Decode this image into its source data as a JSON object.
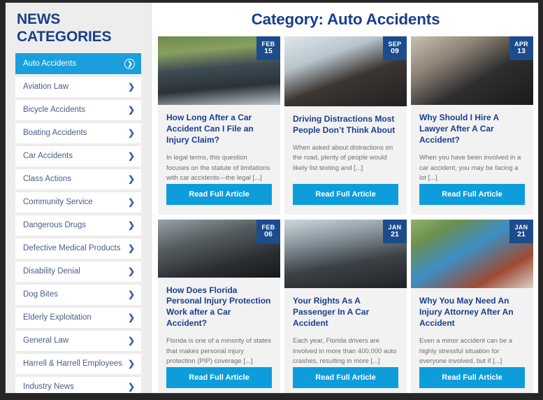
{
  "sidebar": {
    "heading": "NEWS\nCATEGORIES",
    "chevron_icon": "chevron-right-icon",
    "items": [
      {
        "label": "Auto Accidents",
        "active": true
      },
      {
        "label": "Aviation Law",
        "active": false
      },
      {
        "label": "Bicycle Accidents",
        "active": false
      },
      {
        "label": "Boating Accidents",
        "active": false
      },
      {
        "label": "Car Accidents",
        "active": false
      },
      {
        "label": "Class Actions",
        "active": false
      },
      {
        "label": "Community Service",
        "active": false
      },
      {
        "label": "Dangerous Drugs",
        "active": false
      },
      {
        "label": "Defective Medical Products",
        "active": false
      },
      {
        "label": "Disability Denial",
        "active": false
      },
      {
        "label": "Dog Bites",
        "active": false
      },
      {
        "label": "Elderly Exploitation",
        "active": false
      },
      {
        "label": "General Law",
        "active": false
      },
      {
        "label": "Harrell & Harrell Employees",
        "active": false
      },
      {
        "label": "Industry News",
        "active": false
      }
    ]
  },
  "main": {
    "page_title": "Category: Auto Accidents",
    "cta_label": "Read Full Article",
    "articles": [
      {
        "date_month": "FEB",
        "date_day": "15",
        "title": "How Long After a Car Accident Can I File an Injury Claim?",
        "excerpt": "In legal terms, this question focuses on the statute of limitations with car accidents—the legal [...]",
        "cta": "Read Full Article",
        "image_alt": "car-accident-driver-photo"
      },
      {
        "date_month": "SEP",
        "date_day": "09",
        "title": "Driving Distractions Most People Don’t Think About",
        "excerpt": "When asked about distractions on the road, plenty of people would likely list texting and [...]",
        "cta": "Read Full Article",
        "image_alt": "man-driving-car-photo"
      },
      {
        "date_month": "APR",
        "date_day": "13",
        "title": "Why Should I Hire A Lawyer After A Car Accident?",
        "excerpt": "When you have been involved in a car accident, you may be facing a lot [...]",
        "cta": "Read Full Article",
        "image_alt": "woman-on-phone-in-car-photo"
      },
      {
        "date_month": "FEB",
        "date_day": "06",
        "title": "How Does Florida Personal Injury Protection Work after a Car Accident?",
        "excerpt": "Florida is one of a minority of states that makes personal injury protection (PIP) coverage [...]",
        "cta": "Read Full Article",
        "image_alt": "hands-on-steering-wheel-photo"
      },
      {
        "date_month": "JAN",
        "date_day": "21",
        "title": "Your Rights As A Passenger In A Car Accident",
        "excerpt": "Each year, Florida drivers are involved in more than 400,000 auto crashes, resulting in more [...]",
        "cta": "Read Full Article",
        "image_alt": "passengers-inside-car-photo"
      },
      {
        "date_month": "JAN",
        "date_day": "21",
        "title": "Why You May Need An Injury Attorney After An Accident",
        "excerpt": "Even a minor accident can be a highly stressful situation for everyone involved, but if [...]",
        "cta": "Read Full Article",
        "image_alt": "woman-beside-crashed-cars-photo"
      }
    ]
  },
  "colors": {
    "brand_navy": "#1a3e8c",
    "badge_navy": "#1c4c8c",
    "accent_cyan": "#0d9ddb",
    "active_item": "#1a9fdc",
    "sidebar_bg": "#ededed",
    "card_bg": "#f2f2f2",
    "muted_text": "#6f6f6f",
    "link_text": "#4a5c88"
  }
}
